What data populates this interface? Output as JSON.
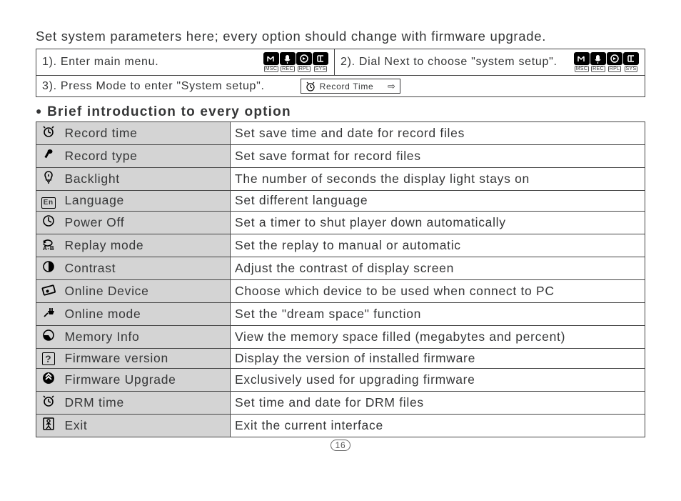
{
  "intro": "Set system parameters here; every option should change with firmware upgrade.",
  "steps": {
    "s1": "1). Enter main menu.",
    "s2": "2). Dial Next to choose \"system setup\".",
    "s3": "3). Press Mode to enter \"System setup\".",
    "recordbox": "Record Time",
    "tabs": [
      "MSC",
      "REC",
      "RPL",
      "SYS"
    ]
  },
  "section_header": "Brief introduction to every option",
  "options": [
    {
      "name": "Record time",
      "desc": "Set save time and date for record files"
    },
    {
      "name": "Record type",
      "desc": "Set save format for record files"
    },
    {
      "name": "Backlight",
      "desc": "The number of seconds the display light stays on"
    },
    {
      "name": "Language",
      "desc": "Set different language"
    },
    {
      "name": "Power Off",
      "desc": "Set a timer to shut player down automatically"
    },
    {
      "name": "Replay mode",
      "desc": "Set the replay to manual or automatic"
    },
    {
      "name": "Contrast",
      "desc": "Adjust the contrast of display screen"
    },
    {
      "name": "Online Device",
      "desc": "Choose which device  to be used when connect  to PC"
    },
    {
      "name": "Online mode",
      "desc": "Set the \"dream space\" function"
    },
    {
      "name": "Memory Info",
      "desc": "View the memory space filled (megabytes and percent)"
    },
    {
      "name": "Firmware version",
      "desc": "Display the version of installed firmware"
    },
    {
      "name": "Firmware Upgrade",
      "desc": "Exclusively used for upgrading firmware"
    },
    {
      "name": "DRM time",
      "desc": "Set time and date for DRM files"
    },
    {
      "name": "Exit",
      "desc": "Exit the current interface"
    }
  ],
  "page_number": "16"
}
